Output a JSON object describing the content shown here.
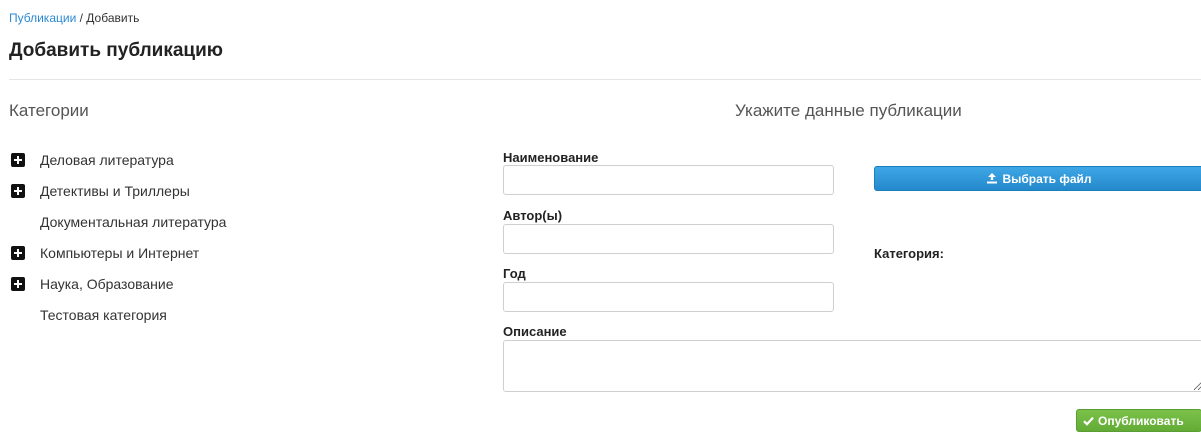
{
  "breadcrumb": {
    "parent": "Публикации",
    "separator": " / ",
    "current": "Добавить"
  },
  "page_title": "Добавить публикацию",
  "categories": {
    "heading": "Категории",
    "items": [
      {
        "label": "Деловая литература",
        "expandable": true
      },
      {
        "label": "Детективы и Триллеры",
        "expandable": true
      },
      {
        "label": "Документальная литература",
        "expandable": false
      },
      {
        "label": "Компьютеры и Интернет",
        "expandable": true
      },
      {
        "label": "Наука, Образование",
        "expandable": true
      },
      {
        "label": "Тестовая категория",
        "expandable": false
      }
    ]
  },
  "form": {
    "heading": "Укажите данные публикации",
    "name_label": "Наименование",
    "name_value": "",
    "author_label": "Автор(ы)",
    "author_value": "",
    "year_label": "Год",
    "year_value": "",
    "description_label": "Описание",
    "description_value": "",
    "file_button_label": "Выбрать файл",
    "category_label": "Категория:",
    "publish_button_label": "Опубликовать"
  },
  "icons": {
    "expand": "plus-square-icon",
    "upload": "upload-icon",
    "check": "check-icon"
  },
  "colors": {
    "link": "#2a8ad4",
    "primary_button": "#2489cc",
    "success_button": "#62ab36"
  }
}
